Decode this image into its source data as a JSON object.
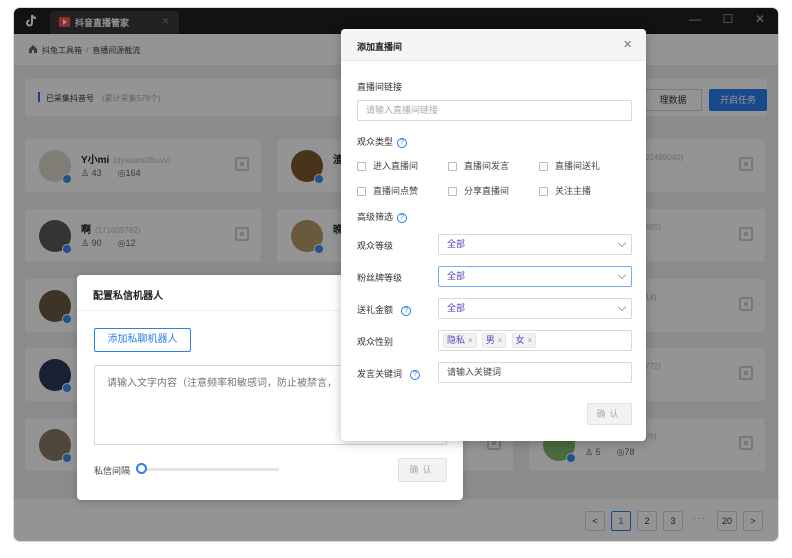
{
  "window": {
    "tab_title": "抖音直播管家",
    "tab_close": "×",
    "controls": [
      "—",
      "☐",
      "✕"
    ]
  },
  "breadcrumb": {
    "root": "抖兔工具箱",
    "separator": "/",
    "current": "直播间源截流"
  },
  "summary": {
    "title": "已采集抖音号",
    "subtitle": "(累计采集578个)",
    "manage_button": "理数据",
    "start_button": "开启任务"
  },
  "cards": [
    {
      "name": "Y小mi",
      "id": "(dyaaam0fhuvv)",
      "followers": "43",
      "views": "164"
    },
    {
      "name": "啊",
      "id": "(171609782)",
      "followers": "90",
      "views": "12"
    },
    {
      "name": "",
      "id": "",
      "followers": "5",
      "views": "78"
    }
  ],
  "fragments": {
    "c2a_name": "渣",
    "c2b_name": "晚",
    "c3a_id": "22499040)",
    "c3b_id": "465)",
    "c3c_id": "14)",
    "c3d_id": "772)",
    "c3e_id": "26)"
  },
  "pagination": {
    "prev": "<",
    "pages": [
      "1",
      "2",
      "3"
    ],
    "dots": "···",
    "last": "20",
    "next": ">"
  },
  "bot_dialog": {
    "title": "配置私信机器人",
    "add_button": "添加私聊机器人",
    "textarea_placeholder": "请输入文字内容（注意频率和敏感词，防止被禁言，",
    "interval_label": "私信间隔",
    "confirm": "确认"
  },
  "live_dialog": {
    "title": "添加直播间",
    "close": "×",
    "link_label": "直播间链接",
    "link_placeholder": "请输入直播间链接",
    "audience_type_label": "观众类型",
    "audience_types": [
      "进入直播间",
      "直播间发言",
      "直播间送礼",
      "直播间点赞",
      "分享直播间",
      "关注主播"
    ],
    "advanced_label": "高级筛选",
    "fields": {
      "level_label": "观众等级",
      "level_value": "全部",
      "fan_label": "粉丝牌等级",
      "fan_value": "全部",
      "gift_label": "送礼金额",
      "gift_value": "全部",
      "gender_label": "观众性别",
      "gender_tags": [
        "隐私",
        "男",
        "女"
      ],
      "keyword_label": "发言关键词",
      "keyword_value": "请输入关键词"
    },
    "confirm": "确认"
  },
  "colors": {
    "primary": "#2a7ff0",
    "tag_text": "#5b3fc5",
    "titlebar": "#1f1f1f"
  }
}
